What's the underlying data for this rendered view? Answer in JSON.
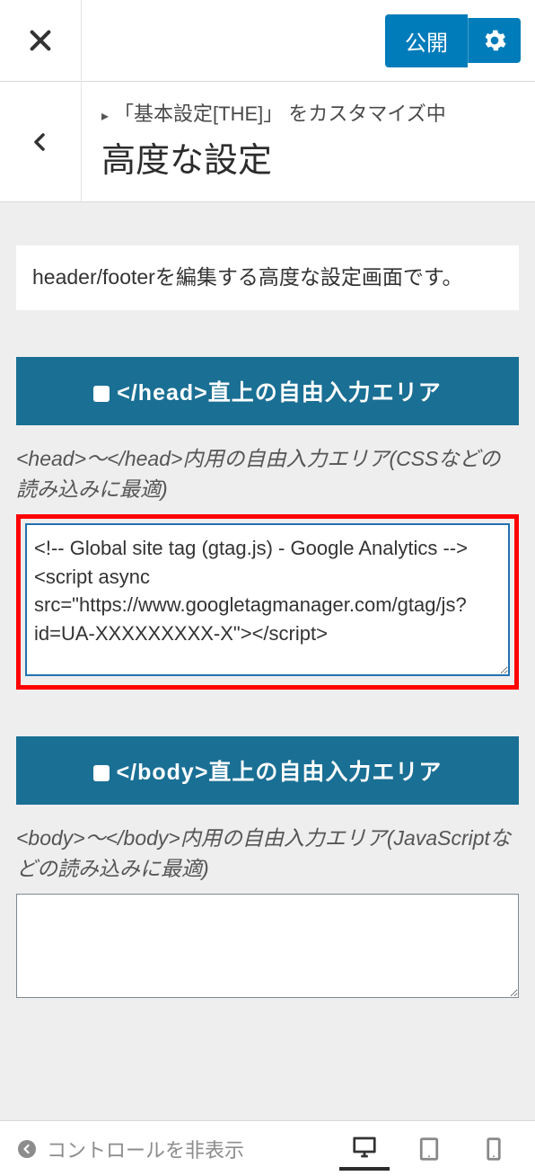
{
  "topbar": {
    "publish_label": "公開",
    "close_label": "閉じる",
    "settings_label": "設定"
  },
  "titlebar": {
    "breadcrumb_prefix": "「基本設定[THE]」 をカスタマイズ中",
    "title": "高度な設定",
    "back_label": "戻る"
  },
  "description": "header/footerを編集する高度な設定画面です。",
  "sections": {
    "head": {
      "header_label": "</head>直上の自由入力エリア",
      "description": "<head>〜</head>内用の自由入力エリア(CSSなどの読み込みに最適)",
      "textarea_value": "<!-- Global site tag (gtag.js) - Google Analytics -->\n<script async src=\"https://www.googletagmanager.com/gtag/js?id=UA-XXXXXXXXX-X\"></script>"
    },
    "body": {
      "header_label": "</body>直上の自由入力エリア",
      "description": "<body>〜</body>内用の自由入力エリア(JavaScriptなどの読み込みに最適)",
      "textarea_value": ""
    }
  },
  "footer": {
    "collapse_label": "コントロールを非表示",
    "device_desktop": "desktop",
    "device_tablet": "tablet",
    "device_mobile": "mobile"
  }
}
